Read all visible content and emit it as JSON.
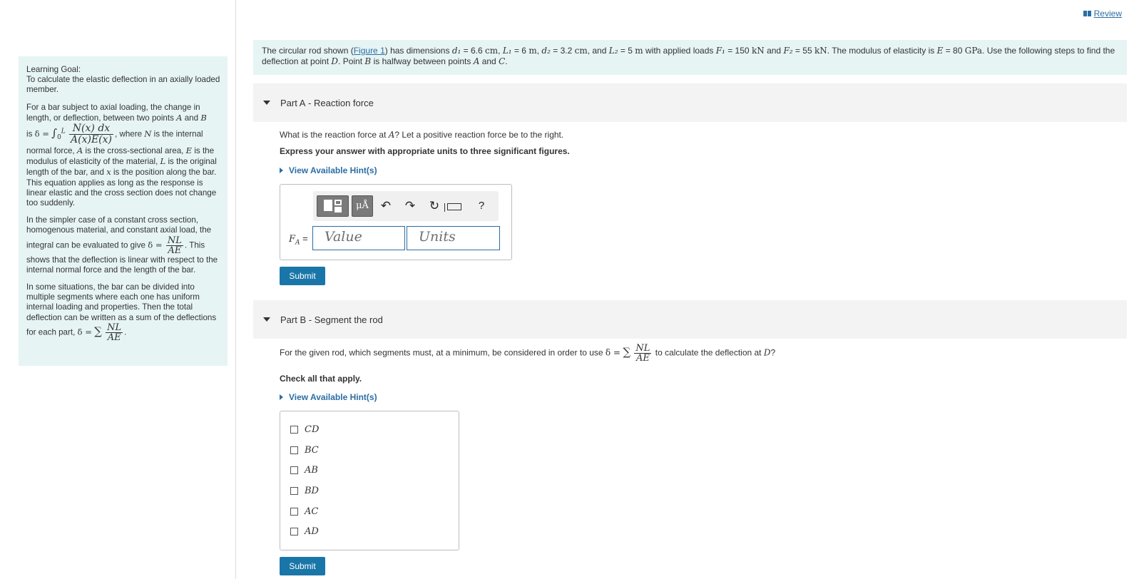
{
  "review": {
    "label": "Review"
  },
  "sidebar": {
    "title": "Learning Goal:",
    "goal": "To calculate the elastic deflection in an axially loaded member.",
    "p1_a": "For a bar subject to axial loading, the change in length, or deflection, between two points",
    "p1_A": "A",
    "p1_and": "and",
    "p1_B": "B",
    "p1_is": "is",
    "p1_delta_eq": "δ =",
    "p1_int": "∫",
    "p1_lower": "0",
    "p1_upper": "L",
    "p1_num": "N(x) dx",
    "p1_den": "A(x)E(x)",
    "p1_comma": ",",
    "p1_where": "where",
    "p1_N": "N",
    "p1_rest1": "is the internal normal force,",
    "p1_A2": "A",
    "p1_rest2": "is the cross-sectional area,",
    "p1_E": "E",
    "p1_rest3": "is the modulus of elasticity of the material,",
    "p1_L": "L",
    "p1_rest4": "is the original length of the bar, and",
    "p1_x": "x",
    "p1_rest5": "is the position along the bar. This equation applies as long as the response is linear elastic and the cross section does not change too suddenly.",
    "p2_a": "In the simpler case of a constant cross section, homogenous material, and constant axial load, the integral can be evaluated to give",
    "p2_delta_eq": "δ =",
    "p2_num": "NL",
    "p2_den": "AE",
    "p2_b": ". This shows that the deflection is linear with respect to the internal normal force and the length of the bar.",
    "p3_a": "In some situations, the bar can be divided into multiple segments where each one has uniform internal loading and properties. Then the total deflection can be written as a sum of the deflections for each part,",
    "p3_delta_eq": "δ =",
    "p3_sum": "∑",
    "p3_num": "NL",
    "p3_den": "AE",
    "p3_end": "."
  },
  "intro": {
    "t1": "The circular rod shown (",
    "figure_link": "Figure 1",
    "t2": ") has dimensions",
    "d1": "d₁",
    "d1_val": "= 6.6",
    "u_cm": "cm",
    "sep1": ",",
    "L1": "L₁",
    "L1_val": "= 6",
    "u_m": "m",
    "sep2": ",",
    "d2": "d₂",
    "d2_val": "= 3.2",
    "u_cm2": "cm",
    "sep3": ", and",
    "L2": "L₂",
    "L2_val": "= 5",
    "u_m2": "m",
    "t3": "with applied loads",
    "F1": "F₁",
    "F1_val": "= 150",
    "u_kN": "kN",
    "t4": "and",
    "F2": "F₂",
    "F2_val": "= 55",
    "u_kN2": "kN",
    "t5": ". The modulus of elasticity is",
    "E": "E",
    "E_val": "= 80",
    "u_GPa": "GPa",
    "t6": ". Use the following steps to find the deflection at point",
    "D": "D",
    "t7": ". Point",
    "B": "B",
    "t8": "is halfway between points",
    "A": "A",
    "t9": "and",
    "C": "C",
    "t10": "."
  },
  "partA": {
    "label": "Part A",
    "title": "- Reaction force",
    "question_a": "What is the reaction force at",
    "question_A": "A",
    "question_b": "? Let a positive reaction force be to the right.",
    "instruction": "Express your answer with appropriate units to three significant figures.",
    "hint": "View Available Hint(s)",
    "units_button": "μÅ",
    "help": "?",
    "var_label": "F",
    "var_sub": "A",
    "var_eq": "=",
    "value_placeholder": "Value",
    "units_placeholder": "Units",
    "submit": "Submit"
  },
  "partB": {
    "label": "Part B",
    "title": "- Segment the rod",
    "question_a": "For the given rod, which segments must, at a minimum, be considered in order to use",
    "question_delta": "δ =",
    "question_sum": "∑",
    "question_num": "NL",
    "question_den": "AE",
    "question_b": "to calculate the deflection at",
    "question_D": "D",
    "question_q": "?",
    "instruction": "Check all that apply.",
    "hint": "View Available Hint(s)",
    "options": [
      "CD",
      "BC",
      "AB",
      "BD",
      "AC",
      "AD"
    ],
    "submit": "Submit"
  }
}
